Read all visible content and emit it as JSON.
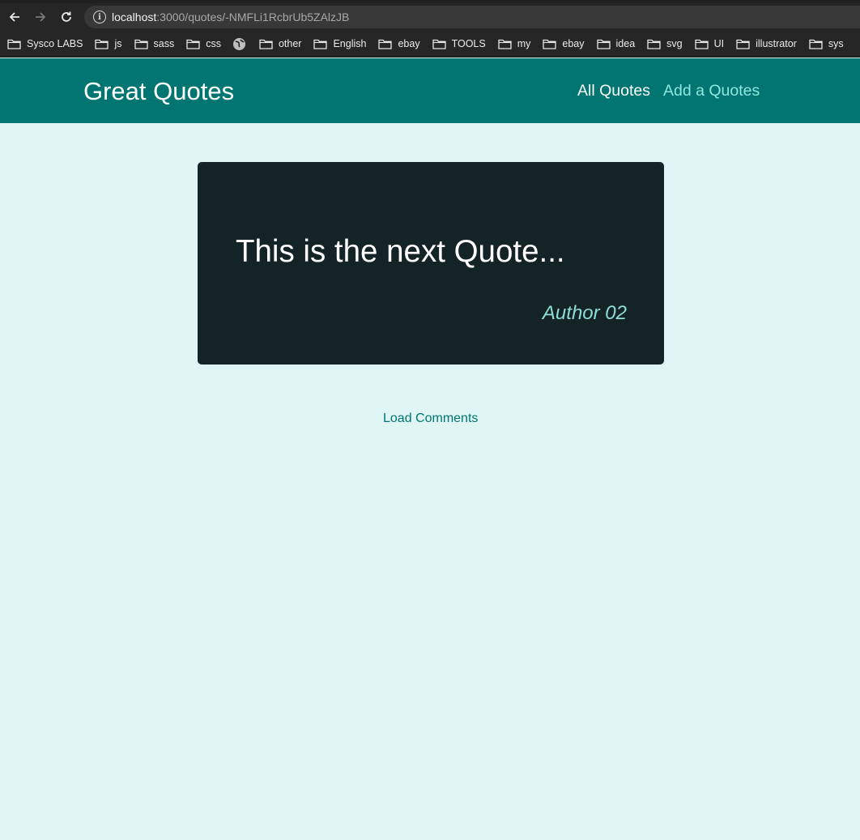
{
  "browser": {
    "url_host": "localhost",
    "url_path": ":3000/quotes/-NMFLi1RcbrUb5ZAlzJB",
    "bookmarks": [
      {
        "label": "Sysco LABS",
        "icon": "folder-icon"
      },
      {
        "label": "js",
        "icon": "folder-icon"
      },
      {
        "label": "sass",
        "icon": "folder-icon"
      },
      {
        "label": "css",
        "icon": "folder-icon"
      },
      {
        "label": "",
        "icon": "globe-icon"
      },
      {
        "label": "other",
        "icon": "folder-icon"
      },
      {
        "label": "English",
        "icon": "folder-icon"
      },
      {
        "label": "ebay",
        "icon": "folder-icon"
      },
      {
        "label": "TOOLS",
        "icon": "folder-icon"
      },
      {
        "label": "my",
        "icon": "folder-icon"
      },
      {
        "label": "ebay",
        "icon": "folder-icon"
      },
      {
        "label": "idea",
        "icon": "folder-icon"
      },
      {
        "label": "svg",
        "icon": "folder-icon"
      },
      {
        "label": "UI",
        "icon": "folder-icon"
      },
      {
        "label": "illustrator",
        "icon": "folder-icon"
      },
      {
        "label": "sys",
        "icon": "folder-icon"
      }
    ]
  },
  "header": {
    "logo": "Great Quotes",
    "nav": {
      "all_quotes": "All Quotes",
      "add_quote": "Add a Quotes"
    }
  },
  "quote": {
    "text": "This is the next Quote...",
    "author": "Author 02"
  },
  "comments": {
    "load_label": "Load Comments"
  },
  "colors": {
    "header_bg": "#007571",
    "page_bg": "#e0f6f4",
    "card_bg": "#142326",
    "accent": "#8fe7df"
  }
}
